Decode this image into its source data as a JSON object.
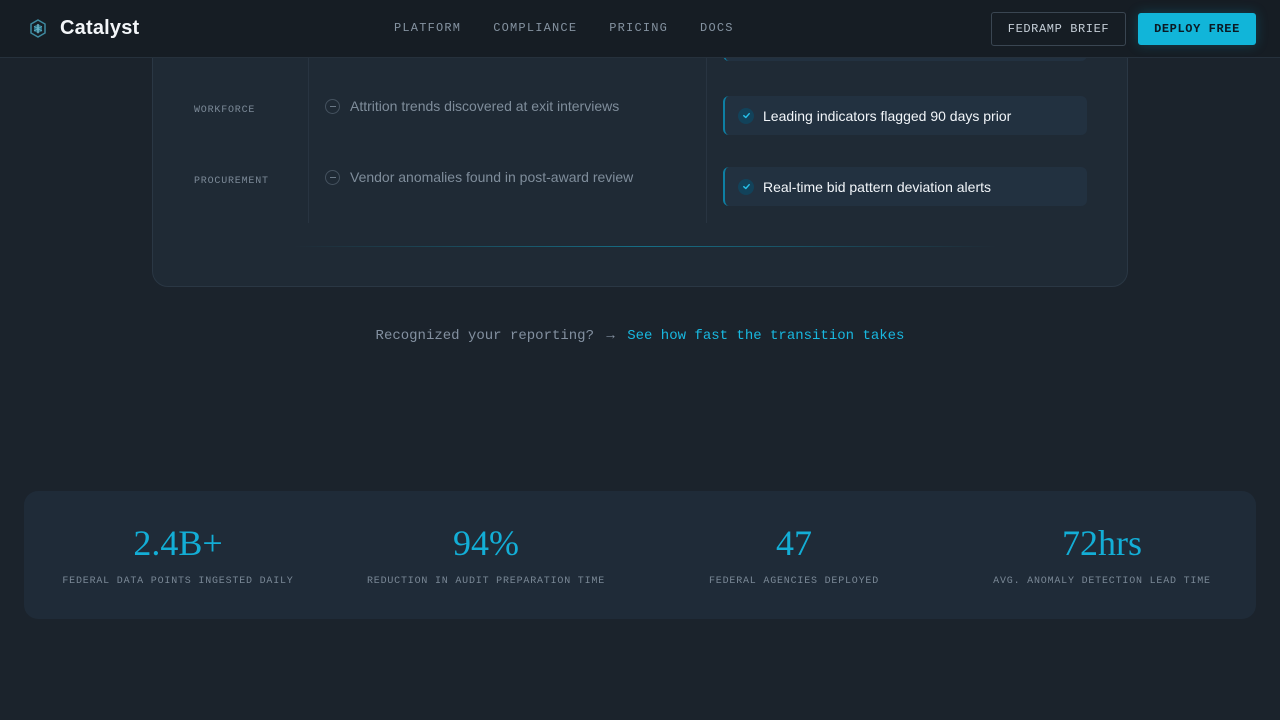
{
  "header": {
    "brand_name": "Catalyst",
    "logo_icon": "hexagon-shield-icon",
    "nav": [
      "PLATFORM",
      "COMPLIANCE",
      "PRICING",
      "DOCS"
    ],
    "secondary_button": "FEDRAMP BRIEF",
    "primary_button": "DEPLOY FREE"
  },
  "comparison": {
    "rows": [
      {
        "label": "WORKFORCE",
        "old": "Attrition trends discovered at exit interviews",
        "new": "Leading indicators flagged 90 days prior"
      },
      {
        "label": "PROCUREMENT",
        "old": "Vendor anomalies found in post-award review",
        "new": "Real-time bid pattern deviation alerts"
      }
    ]
  },
  "cta": {
    "prompt": "Recognized your reporting?",
    "arrow": "→",
    "link": "See how fast the transition takes"
  },
  "stats": [
    {
      "value": "2.4B+",
      "label": "FEDERAL DATA POINTS INGESTED DAILY"
    },
    {
      "value": "94%",
      "label": "REDUCTION IN AUDIT PREPARATION TIME"
    },
    {
      "value": "47",
      "label": "FEDERAL AGENCIES DEPLOYED"
    },
    {
      "value": "72hrs",
      "label": "AVG. ANOMALY DETECTION LEAD TIME"
    }
  ],
  "colors": {
    "background": "#1b232c",
    "accent": "#11b5d9",
    "card": "#1f2a35"
  }
}
